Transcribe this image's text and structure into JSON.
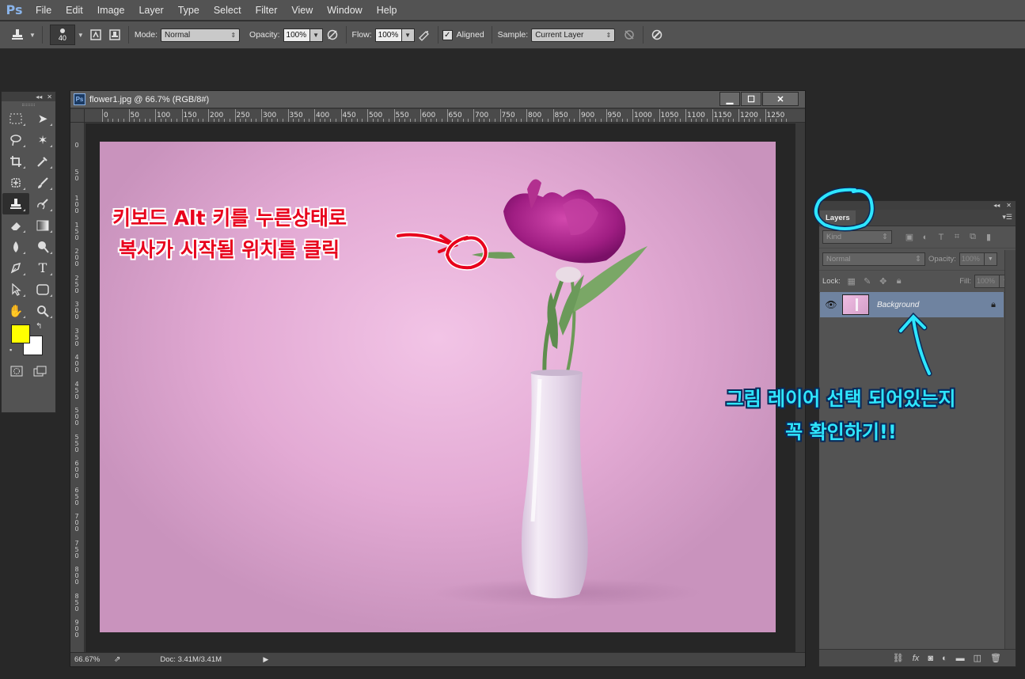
{
  "app": {
    "logo": "Ps"
  },
  "menu": [
    "File",
    "Edit",
    "Image",
    "Layer",
    "Type",
    "Select",
    "Filter",
    "View",
    "Window",
    "Help"
  ],
  "options": {
    "brush_size": "40",
    "mode_label": "Mode:",
    "mode_value": "Normal",
    "opacity_label": "Opacity:",
    "opacity_value": "100%",
    "flow_label": "Flow:",
    "flow_value": "100%",
    "aligned_label": "Aligned",
    "sample_label": "Sample:",
    "sample_value": "Current Layer"
  },
  "document": {
    "title": "flower1.jpg @ 66.7% (RGB/8#)",
    "ruler_top": [
      "0",
      "50",
      "100",
      "150",
      "200",
      "250",
      "300",
      "350",
      "400",
      "450",
      "500",
      "550",
      "600",
      "650",
      "700",
      "750",
      "800",
      "850",
      "900",
      "950",
      "1000",
      "1050",
      "1100",
      "1150",
      "1200",
      "1250"
    ],
    "ruler_left": [
      "0",
      "50",
      "100",
      "150",
      "200",
      "250",
      "300",
      "350",
      "400",
      "450",
      "500",
      "550",
      "600",
      "650",
      "700",
      "750",
      "800",
      "850",
      "900"
    ],
    "zoom": "66.67%",
    "doc_size": "Doc: 3.41M/3.41M",
    "win_minimize": "▁",
    "win_restore": "☐",
    "win_close": "✕"
  },
  "layers": {
    "tab": "Layers",
    "kind": "Kind",
    "blend_mode": "Normal",
    "opacity_label": "Opacity:",
    "opacity_value": "100%",
    "lock_label": "Lock:",
    "fill_label": "Fill:",
    "fill_value": "100%",
    "items": [
      {
        "name": "Background"
      }
    ]
  },
  "annotations": {
    "red_line1": "키보드 Alt 키를 누른상태로",
    "red_line2": "복사가 시작될 위치를 클릭",
    "cyan_line1": "그림 레이어 선택 되어있는지",
    "cyan_line2": "꼭 확인하기!!"
  },
  "colors": {
    "foreground": "#ffff00",
    "background": "#ffffff",
    "layer_selected": "#6f83a0",
    "annotation_red": "#e8001c",
    "annotation_cyan": "#2ee6ff"
  }
}
